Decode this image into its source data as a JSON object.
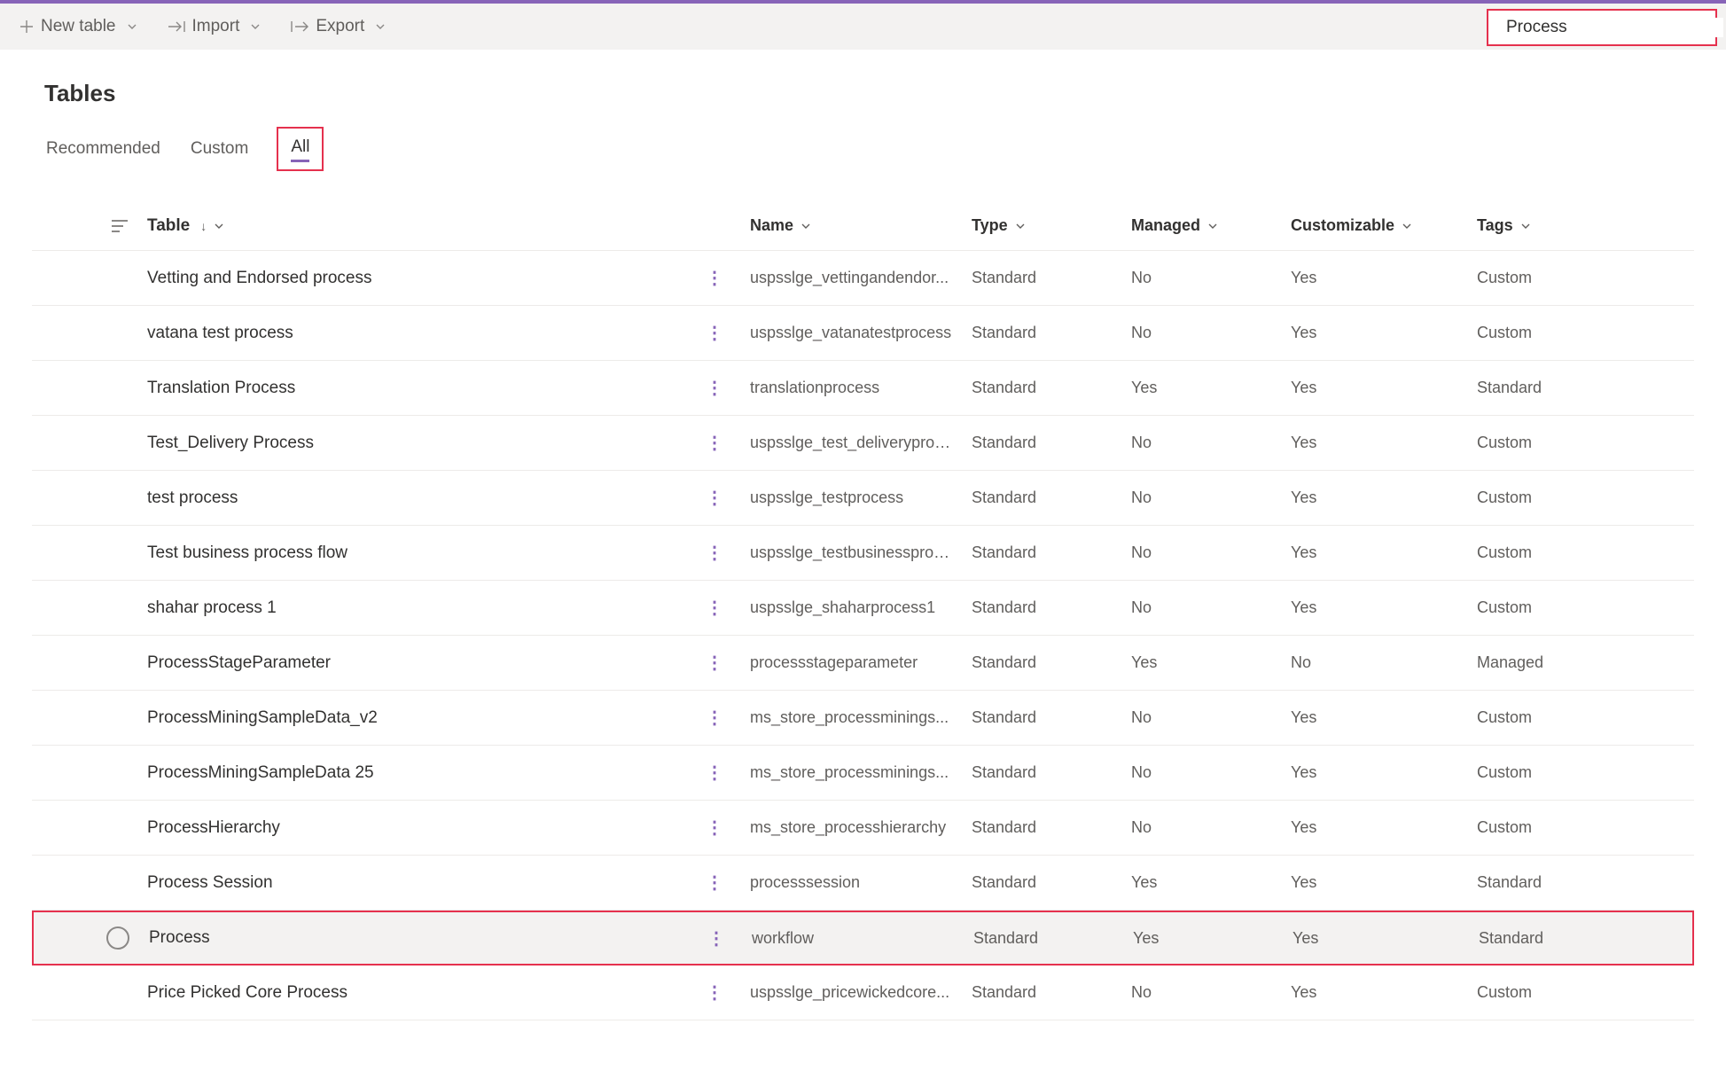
{
  "toolbar": {
    "new_table": "New table",
    "import": "Import",
    "export": "Export"
  },
  "search": {
    "value": "Process"
  },
  "page": {
    "title": "Tables"
  },
  "tabs": {
    "recommended": "Recommended",
    "custom": "Custom",
    "all": "All"
  },
  "columns": {
    "table": "Table",
    "name": "Name",
    "type": "Type",
    "managed": "Managed",
    "customizable": "Customizable",
    "tags": "Tags"
  },
  "rows": [
    {
      "table": "Vetting and Endorsed process",
      "name": "uspsslge_vettingandendor...",
      "type": "Standard",
      "managed": "No",
      "customizable": "Yes",
      "tags": "Custom",
      "highlight": false
    },
    {
      "table": "vatana test process",
      "name": "uspsslge_vatanatestprocess",
      "type": "Standard",
      "managed": "No",
      "customizable": "Yes",
      "tags": "Custom",
      "highlight": false
    },
    {
      "table": "Translation Process",
      "name": "translationprocess",
      "type": "Standard",
      "managed": "Yes",
      "customizable": "Yes",
      "tags": "Standard",
      "highlight": false
    },
    {
      "table": "Test_Delivery Process",
      "name": "uspsslge_test_deliveryproc...",
      "type": "Standard",
      "managed": "No",
      "customizable": "Yes",
      "tags": "Custom",
      "highlight": false
    },
    {
      "table": "test process",
      "name": "uspsslge_testprocess",
      "type": "Standard",
      "managed": "No",
      "customizable": "Yes",
      "tags": "Custom",
      "highlight": false
    },
    {
      "table": "Test business process flow",
      "name": "uspsslge_testbusinessproc...",
      "type": "Standard",
      "managed": "No",
      "customizable": "Yes",
      "tags": "Custom",
      "highlight": false
    },
    {
      "table": "shahar process 1",
      "name": "uspsslge_shaharprocess1",
      "type": "Standard",
      "managed": "No",
      "customizable": "Yes",
      "tags": "Custom",
      "highlight": false
    },
    {
      "table": "ProcessStageParameter",
      "name": "processstageparameter",
      "type": "Standard",
      "managed": "Yes",
      "customizable": "No",
      "tags": "Managed",
      "highlight": false
    },
    {
      "table": "ProcessMiningSampleData_v2",
      "name": "ms_store_processminings...",
      "type": "Standard",
      "managed": "No",
      "customizable": "Yes",
      "tags": "Custom",
      "highlight": false
    },
    {
      "table": "ProcessMiningSampleData 25",
      "name": "ms_store_processminings...",
      "type": "Standard",
      "managed": "No",
      "customizable": "Yes",
      "tags": "Custom",
      "highlight": false
    },
    {
      "table": "ProcessHierarchy",
      "name": "ms_store_processhierarchy",
      "type": "Standard",
      "managed": "No",
      "customizable": "Yes",
      "tags": "Custom",
      "highlight": false
    },
    {
      "table": "Process Session",
      "name": "processsession",
      "type": "Standard",
      "managed": "Yes",
      "customizable": "Yes",
      "tags": "Standard",
      "highlight": false
    },
    {
      "table": "Process",
      "name": "workflow",
      "type": "Standard",
      "managed": "Yes",
      "customizable": "Yes",
      "tags": "Standard",
      "highlight": true
    },
    {
      "table": "Price Picked Core Process",
      "name": "uspsslge_pricewickedcore...",
      "type": "Standard",
      "managed": "No",
      "customizable": "Yes",
      "tags": "Custom",
      "highlight": false
    }
  ]
}
